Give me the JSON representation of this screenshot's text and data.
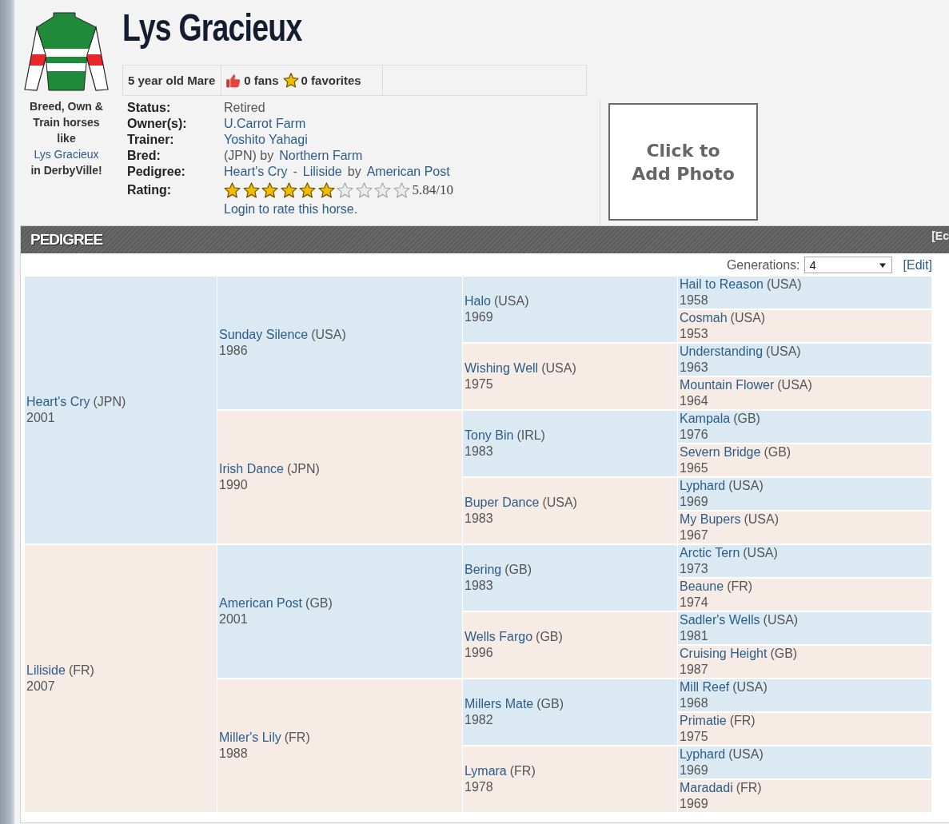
{
  "horse": {
    "name": "Lys Gracieux",
    "summary": "5 year old Mare",
    "fans": "0 fans",
    "favorites": "0 favorites"
  },
  "promo": {
    "before": "Breed, Own & Train horses like",
    "link": "Lys Gracieux",
    "after": "in DerbyVille!"
  },
  "details": [
    {
      "label": "Status:",
      "parts": [
        {
          "kind": "text",
          "text": "Retired"
        }
      ]
    },
    {
      "label": "Owner(s):",
      "parts": [
        {
          "kind": "link",
          "text": "U.Carrot Farm"
        }
      ]
    },
    {
      "label": "Trainer:",
      "parts": [
        {
          "kind": "link",
          "text": "Yoshito Yahagi"
        }
      ]
    },
    {
      "label": "Bred:",
      "parts": [
        {
          "kind": "text",
          "text": "(JPN) by"
        },
        {
          "kind": "link",
          "text": "Northern Farm"
        }
      ]
    },
    {
      "label": "Pedigree:",
      "parts": [
        {
          "kind": "link",
          "text": "Heart's Cry"
        },
        {
          "kind": "text",
          "text": "-"
        },
        {
          "kind": "link",
          "text": "Liliside"
        },
        {
          "kind": "text",
          "text": "by"
        },
        {
          "kind": "link",
          "text": "American Post"
        }
      ]
    }
  ],
  "rating": {
    "label": "Rating:",
    "stars": 6,
    "reading": "5.84/10",
    "login_link": "Login to rate this horse."
  },
  "photo": {
    "label": "Click to Add Photo"
  },
  "pedigree": {
    "title": "PEDIGREE",
    "header_link": "[Ec",
    "generations_label": "Generations:",
    "generations_value": "4",
    "edit_link": "[Edit]",
    "tree": [
      {
        "name": "Heart's Cry",
        "country": "(JPN)",
        "year": "2001",
        "kind": "sire",
        "children": [
          {
            "name": "Sunday Silence",
            "country": "(USA)",
            "year": "1986",
            "kind": "sire",
            "children": [
              {
                "name": "Halo",
                "country": "(USA)",
                "year": "1969",
                "kind": "sire",
                "children": [
                  {
                    "name": "Hail to Reason",
                    "country": "(USA)",
                    "year": "1958",
                    "kind": "sire"
                  },
                  {
                    "name": "Cosmah",
                    "country": "(USA)",
                    "year": "1953",
                    "kind": "dam"
                  }
                ]
              },
              {
                "name": "Wishing Well",
                "country": "(USA)",
                "year": "1975",
                "kind": "dam",
                "children": [
                  {
                    "name": "Understanding",
                    "country": "(USA)",
                    "year": "1963",
                    "kind": "sire"
                  },
                  {
                    "name": "Mountain Flower",
                    "country": "(USA)",
                    "year": "1964",
                    "kind": "dam"
                  }
                ]
              }
            ]
          },
          {
            "name": "Irish Dance",
            "country": "(JPN)",
            "year": "1990",
            "kind": "dam",
            "children": [
              {
                "name": "Tony Bin",
                "country": "(IRL)",
                "year": "1983",
                "kind": "sire",
                "children": [
                  {
                    "name": "Kampala",
                    "country": "(GB)",
                    "year": "1976",
                    "kind": "sire"
                  },
                  {
                    "name": "Severn Bridge",
                    "country": "(GB)",
                    "year": "1965",
                    "kind": "dam"
                  }
                ]
              },
              {
                "name": "Buper Dance",
                "country": "(USA)",
                "year": "1983",
                "kind": "dam",
                "children": [
                  {
                    "name": "Lyphard",
                    "country": "(USA)",
                    "year": "1969",
                    "kind": "sire"
                  },
                  {
                    "name": "My Bupers",
                    "country": "(USA)",
                    "year": "1967",
                    "kind": "dam"
                  }
                ]
              }
            ]
          }
        ]
      },
      {
        "name": "Liliside",
        "country": "(FR)",
        "year": "2007",
        "kind": "dam",
        "children": [
          {
            "name": "American Post",
            "country": "(GB)",
            "year": "2001",
            "kind": "sire",
            "children": [
              {
                "name": "Bering",
                "country": "(GB)",
                "year": "1983",
                "kind": "sire",
                "children": [
                  {
                    "name": "Arctic Tern",
                    "country": "(USA)",
                    "year": "1973",
                    "kind": "sire"
                  },
                  {
                    "name": "Beaune",
                    "country": "(FR)",
                    "year": "1974",
                    "kind": "dam"
                  }
                ]
              },
              {
                "name": "Wells Fargo",
                "country": "(GB)",
                "year": "1996",
                "kind": "dam",
                "children": [
                  {
                    "name": "Sadler's Wells",
                    "country": "(USA)",
                    "year": "1981",
                    "kind": "sire"
                  },
                  {
                    "name": "Cruising Height",
                    "country": "(GB)",
                    "year": "1987",
                    "kind": "dam"
                  }
                ]
              }
            ]
          },
          {
            "name": "Miller's Lily",
            "country": "(FR)",
            "year": "1988",
            "kind": "dam",
            "children": [
              {
                "name": "Millers Mate",
                "country": "(GB)",
                "year": "1982",
                "kind": "sire",
                "children": [
                  {
                    "name": "Mill Reef",
                    "country": "(USA)",
                    "year": "1968",
                    "kind": "sire"
                  },
                  {
                    "name": "Primatie",
                    "country": "(FR)",
                    "year": "1975",
                    "kind": "dam"
                  }
                ]
              },
              {
                "name": "Lymara",
                "country": "(FR)",
                "year": "1978",
                "kind": "dam",
                "children": [
                  {
                    "name": "Lyphard",
                    "country": "(USA)",
                    "year": "1969",
                    "kind": "sire"
                  },
                  {
                    "name": "Maradadi",
                    "country": "(FR)",
                    "year": "1969",
                    "kind": "dam"
                  }
                ]
              }
            ]
          }
        ]
      }
    ]
  }
}
